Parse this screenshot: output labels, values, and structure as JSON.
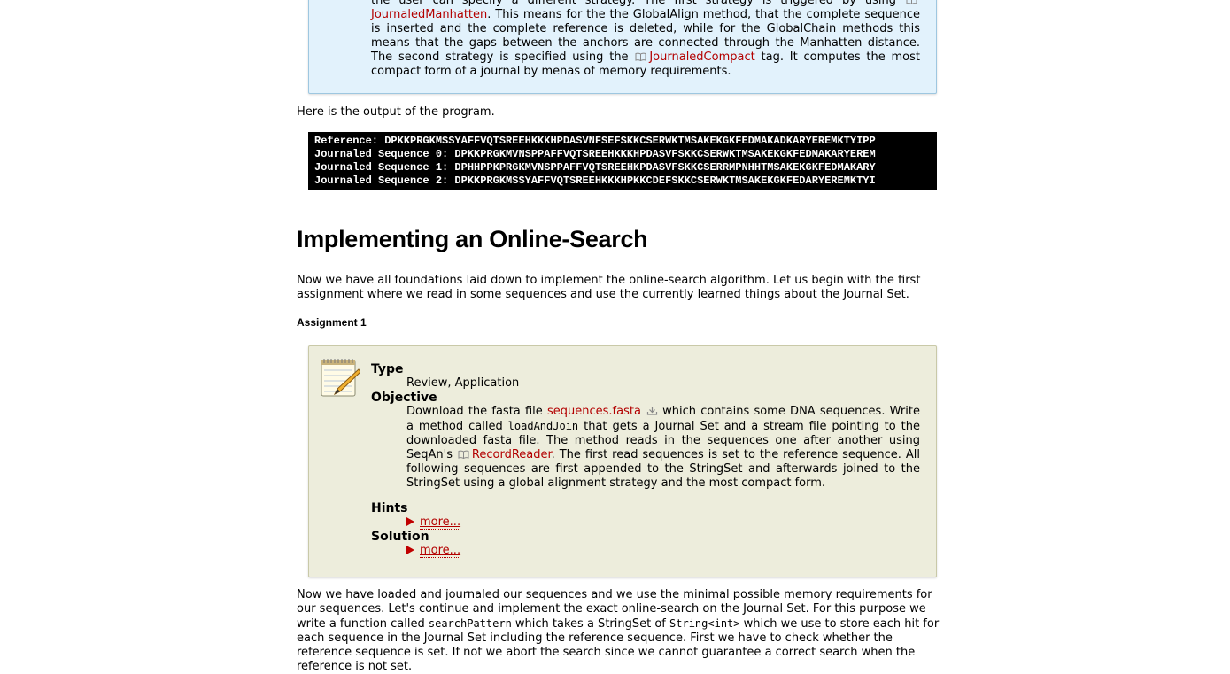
{
  "info_box": {
    "line0": "the user can specify a different strategy. The first strategy is triggered by using",
    "link1": "JournaledManhatten",
    "text1": ". This means for the the GlobalAlign method, that the complete sequence is inserted and the complete reference is deleted, while for the GlobalChain methods this means that the gaps between the anchors are connected through the Manhatten distance. The second strategy is specified using the ",
    "link2": "JournaledCompact",
    "text2": " tag. It computes the most compact form of a journal by menas of memory requirements."
  },
  "output_intro": "Here is the output of the program.",
  "console_lines": [
    "Reference: DPKKPRGKMSSYAFFVQTSREEHKKKHPDASVNFSEFSKKCSERWKTMSAKEKGKFEDMAKADKARYEREMKTYIPP",
    "Journaled Sequence 0: DPKKPRGKMVNSPPAFFVQTSREEHKKKHPDASVFSKKCSERWKTMSAKEKGKFEDMAKARYEREM",
    "Journaled Sequence 1: DPHHPPKPRGKMVNSPPAFFVQTSREEHKPDASVFSKKCSERRMPNHHTMSAKEKGKFEDMAKARY",
    "Journaled Sequence 2: DPKKPRGKMSSYAFFVQTSREEHKKKHPKKCDEFSKKCSERWKTMSAKEKGKFEDARYEREMKTYI"
  ],
  "heading": "Implementing an Online-Search",
  "intro_para": "Now we have all foundations laid down to implement the online-search algorithm. Let us begin with the first assignment where we read in some sequences and use the currently learned things about the Journal Set.",
  "assignment_label": "Assignment 1",
  "assignment": {
    "type_label": "Type",
    "type_value": "Review, Application",
    "objective_label": "Objective",
    "obj_text1": "Download the fasta file ",
    "obj_link_fasta": "sequences.fasta",
    "obj_text2": " which contains some DNA sequences. Write a method called ",
    "obj_code": "loadAndJoin",
    "obj_text3": " that gets a Journal Set and a stream file pointing to the downloaded fasta file. The method reads in the sequences one after another using SeqAn's ",
    "obj_link_reader": "RecordReader",
    "obj_text4": ". The first read sequences is set to the reference sequence. All following sequences are first appended to the StringSet and afterwards joined to the StringSet using a global alignment strategy and the most compact form.",
    "hints_label": "Hints",
    "hints_more": "more...",
    "solution_label": "Solution",
    "solution_more": "more..."
  },
  "bottom_para": {
    "t1": "Now we have loaded and journaled our sequences and we use the minimal possible memory requirements for our sequences. Let's continue and implement the exact online-search on the Journal Set. For this purpose we write a function called ",
    "code1": "searchPattern",
    "t2": " which takes a StringSet of ",
    "code2": "String<int>",
    "t3": " which we use to store each hit for each sequence in the Journal Set including the reference sequence. First we have to check whether the reference sequence is set. If not we abort the search since we cannot guarantee a correct search when the reference is not set."
  },
  "colors": {
    "link": "#b30000",
    "info_bg": "#e2f2fc",
    "assign_bg": "#ededdc",
    "console_bg": "#000000"
  },
  "icons": [
    "book-icon",
    "download-icon",
    "notepad-icon",
    "triangle-right-icon"
  ]
}
